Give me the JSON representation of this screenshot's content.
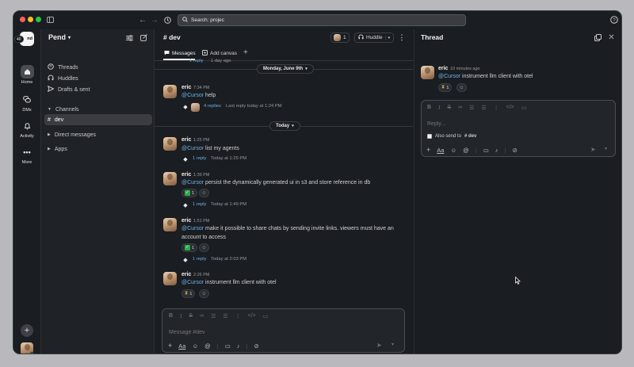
{
  "search": {
    "label": "Search: projec"
  },
  "workspace": {
    "badge": "40",
    "name": "Pend"
  },
  "rail": {
    "items": [
      {
        "label": "Home",
        "icon": "home-icon"
      },
      {
        "label": "DMs",
        "icon": "dms-icon"
      },
      {
        "label": "Activity",
        "icon": "bell-icon"
      },
      {
        "label": "More",
        "icon": "more-icon"
      }
    ]
  },
  "sidebar": {
    "items": [
      {
        "label": "Threads",
        "icon": "threads-icon"
      },
      {
        "label": "Huddles",
        "icon": "headphones-icon"
      },
      {
        "label": "Drafts & sent",
        "icon": "send-icon"
      }
    ],
    "channels_header": "Channels",
    "channel": "dev",
    "direct_messages": "Direct messages",
    "apps": "Apps"
  },
  "channel": {
    "title": "# dev",
    "member_count": "1",
    "huddle_label": "Huddle",
    "tabs": [
      {
        "label": "Messages"
      },
      {
        "label": "Add canvas"
      }
    ]
  },
  "messages": {
    "top_partial": {
      "reply": "1 reply",
      "meta": "1 day ago"
    },
    "date_monday": "Monday, June 9th",
    "m1": {
      "author": "eric",
      "time": "7:34 PM",
      "mention": "@Cursor",
      "text": " help",
      "replies": "4 replies",
      "meta": "Last reply today at 1:24 PM"
    },
    "date_today": "Today",
    "m2": {
      "author": "eric",
      "time": "1:25 PM",
      "mention": "@Cursor",
      "text": " list my agents",
      "replies": "1 reply",
      "meta": "Today at 1:25 PM"
    },
    "m3": {
      "author": "eric",
      "time": "1:39 PM",
      "mention": "@Cursor",
      "text": " persist the dynamically generated ui in s3 and store reference in db",
      "reaction_count": "1",
      "replies": "1 reply",
      "meta": "Today at 1:49 PM"
    },
    "m4": {
      "author": "eric",
      "time": "1:51 PM",
      "mention": "@Cursor",
      "text_line1": " make it possible to share chats by sending invite links. viewers must have an",
      "text_line2": "account to access",
      "reaction_count": "1",
      "replies": "1 reply",
      "meta": "Today at 2:03 PM"
    },
    "m5": {
      "author": "eric",
      "time": "2:26 PM",
      "mention": "@Cursor",
      "text": " instrument llm client with otel",
      "reaction_count": "1"
    }
  },
  "composer": {
    "placeholder": "Message #dev"
  },
  "thread": {
    "title": "Thread",
    "author": "eric",
    "time": "10 minutes ago",
    "mention": "@Cursor",
    "text": " instrument llm client with otel",
    "reaction_count": "1",
    "reply_placeholder": "Reply...",
    "also_send": "Also send to",
    "also_send_channel": "# dev"
  },
  "colors": {
    "accent": "#6fb2e9",
    "background": "#1a1d21",
    "sidebar": "#1f2226",
    "active": "#3a3c41"
  }
}
